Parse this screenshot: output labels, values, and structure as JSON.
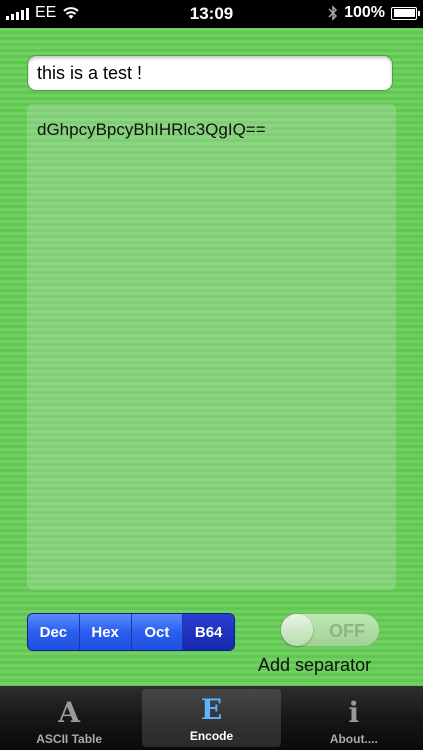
{
  "status_bar": {
    "carrier": "EE",
    "time": "13:09",
    "battery": "100%"
  },
  "input": {
    "value": "this is a test !"
  },
  "output": {
    "text": "dGhpcyBpcyBhIHRlc3QgIQ=="
  },
  "encoding": {
    "options": [
      "Dec",
      "Hex",
      "Oct",
      "B64"
    ],
    "selected": "B64"
  },
  "separator": {
    "toggle_label": "OFF",
    "label": "Add separator",
    "enabled": false
  },
  "tabs": [
    {
      "label": "ASCII Table",
      "icon": "A",
      "selected": false
    },
    {
      "label": "Encode",
      "icon": "E",
      "selected": true
    },
    {
      "label": "About....",
      "icon": "i",
      "selected": false
    }
  ]
}
